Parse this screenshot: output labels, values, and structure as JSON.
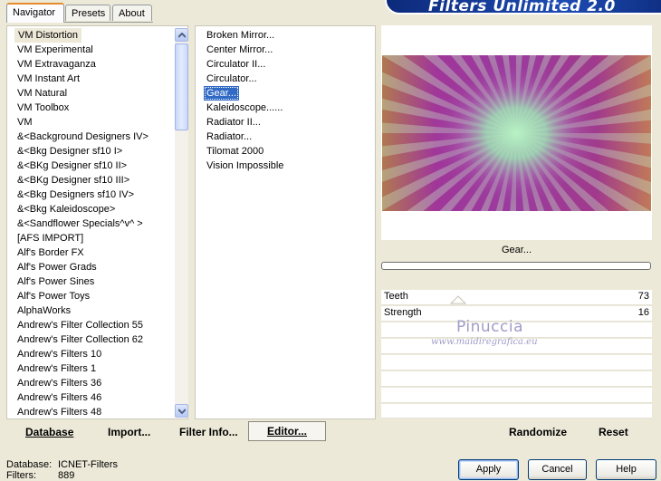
{
  "banner": {
    "title": "Filters Unlimited 2.0"
  },
  "tabs": [
    {
      "label": "Navigator",
      "active": true
    },
    {
      "label": "Presets",
      "active": false
    },
    {
      "label": "About",
      "active": false
    }
  ],
  "categories": [
    "VM Distortion",
    "VM Experimental",
    "VM Extravaganza",
    "VM Instant Art",
    "VM Natural",
    "VM Toolbox",
    "VM",
    "&<Background Designers IV>",
    "&<Bkg Designer sf10 I>",
    "&<BKg Designer sf10 II>",
    "&<BKg Designer sf10 III>",
    "&<Bkg Designers sf10 IV>",
    "&<Bkg Kaleidoscope>",
    "&<Sandflower Specials^v^ >",
    "[AFS IMPORT]",
    "Alf's Border FX",
    "Alf's Power Grads",
    "Alf's Power Sines",
    "Alf's Power Toys",
    "AlphaWorks",
    "Andrew's Filter Collection 55",
    "Andrew's Filter Collection 62",
    "Andrew's Filters 10",
    "Andrew's Filters 1",
    "Andrew's Filters 36",
    "Andrew's Filters 46",
    "Andrew's Filters 48"
  ],
  "selected_category": "VM Distortion",
  "filters": [
    "Broken Mirror...",
    "Center Mirror...",
    "Circulator II...",
    "Circulator...",
    "Gear...",
    "Kaleidoscope......",
    "Radiator II...",
    "Radiator...",
    "Tilomat 2000",
    "Vision Impossible"
  ],
  "selected_filter": "Gear...",
  "preview": {
    "filter_name": "Gear..."
  },
  "params": [
    {
      "label": "Teeth",
      "value": "73"
    },
    {
      "label": "Strength",
      "value": "16"
    }
  ],
  "watermark": {
    "line1": "Pinuccia",
    "line2": "www.maidiregrafica.eu"
  },
  "toolbar": {
    "database": "Database",
    "import": "Import...",
    "filter_info": "Filter Info...",
    "editor": "Editor...",
    "randomize": "Randomize",
    "reset": "Reset"
  },
  "status": {
    "database_label": "Database:",
    "database_value": "ICNET-Filters",
    "filters_label": "Filters:",
    "filters_value": "889"
  },
  "buttons": {
    "apply": "Apply",
    "cancel": "Cancel",
    "help": "Help"
  },
  "colors": {
    "selection": "#316ac5",
    "banner": "#1d4bb3",
    "tab_accent": "#e68b2c"
  }
}
